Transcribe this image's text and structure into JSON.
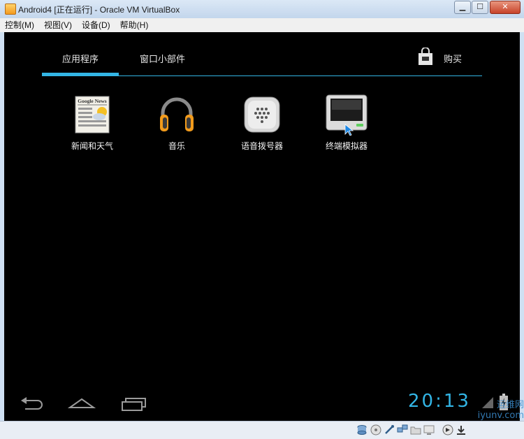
{
  "window": {
    "title": "Android4 [正在运行] - Oracle VM VirtualBox",
    "minimize": "▁",
    "maximize": "☐",
    "close": "✕"
  },
  "menubar": {
    "items": [
      "控制(M)",
      "视图(V)",
      "设备(D)",
      "帮助(H)"
    ]
  },
  "launcher": {
    "tabs": [
      "应用程序",
      "窗口小部件"
    ],
    "active_tab": "应用程序",
    "store_label": "购买",
    "apps": [
      {
        "label": "新闻和天气",
        "icon": "news-weather-icon"
      },
      {
        "label": "音乐",
        "icon": "headphones-icon"
      },
      {
        "label": "语音拨号器",
        "icon": "voice-dialer-icon"
      },
      {
        "label": "终端模拟器",
        "icon": "terminal-icon"
      }
    ],
    "news_icon_text": "Google News"
  },
  "system_bar": {
    "time": "20:13",
    "nav": [
      "back-icon",
      "home-icon",
      "recent-apps-icon"
    ]
  },
  "watermark": {
    "line1": "运维网",
    "line2": "iyunv.com"
  },
  "colors": {
    "accent": "#33b5e5",
    "screen_bg": "#000000",
    "frame": "#cfe0f2"
  }
}
